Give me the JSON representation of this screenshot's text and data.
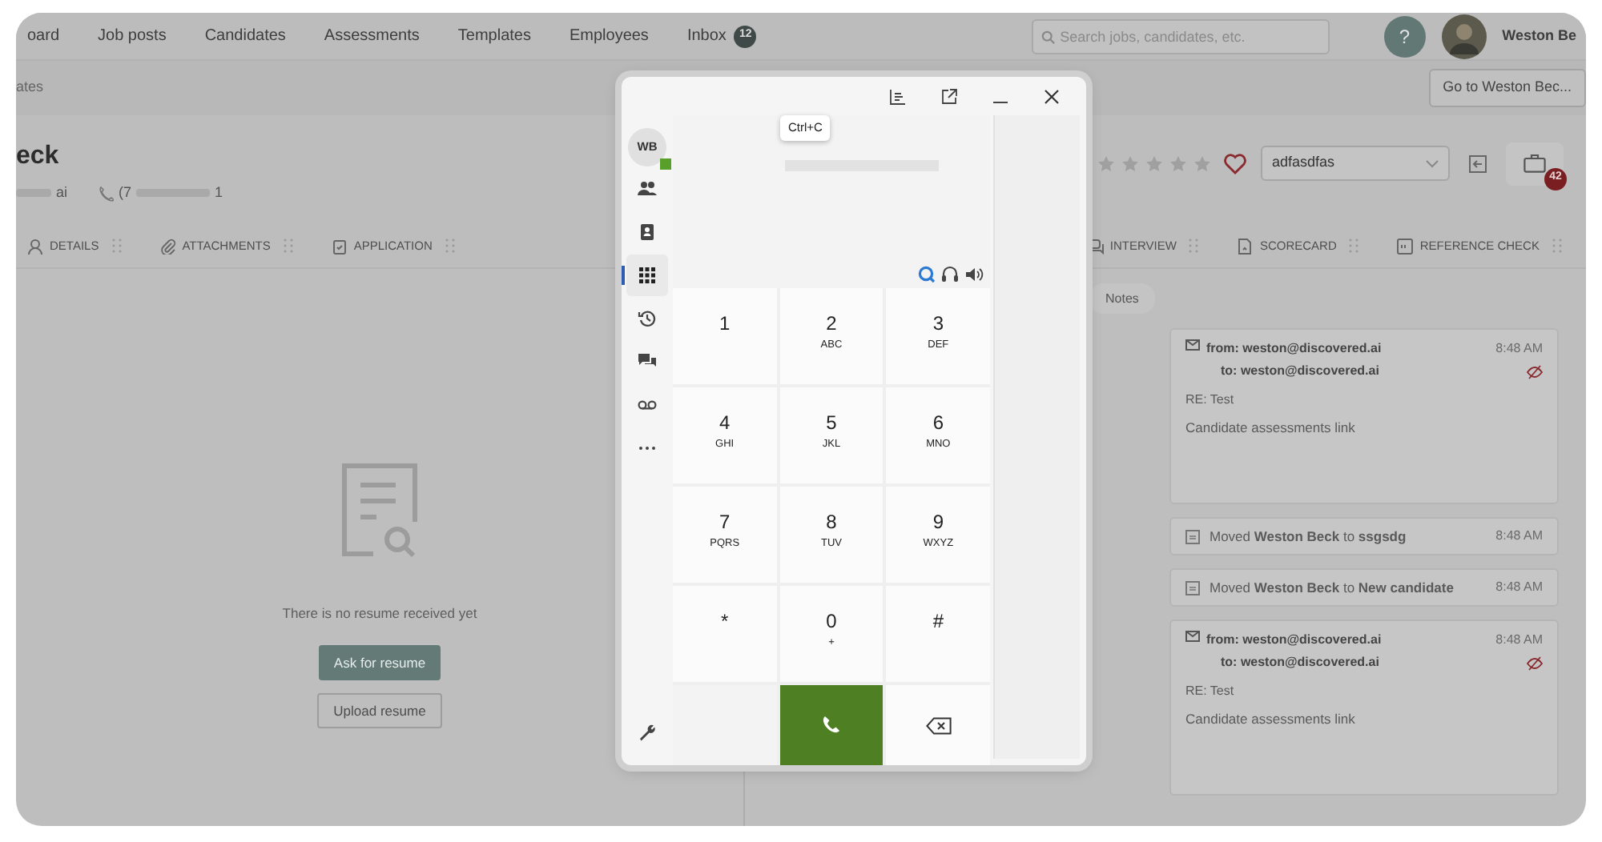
{
  "nav": {
    "items": [
      {
        "label": "oard"
      },
      {
        "label": "Job posts"
      },
      {
        "label": "Candidates"
      },
      {
        "label": "Assessments"
      },
      {
        "label": "Templates"
      },
      {
        "label": "Employees"
      },
      {
        "label": "Inbox",
        "badge": "12"
      }
    ],
    "search": {
      "placeholder": "Search jobs, candidates, etc."
    },
    "help": "?",
    "user": {
      "name": "Weston Be"
    }
  },
  "breadcrumb": "ates",
  "goto_button": "Go to Weston Bec...",
  "candidate": {
    "name": "eck",
    "email": "ai",
    "phone_start": "(7",
    "phone_end": "1",
    "rating": {
      "stars": 0
    },
    "favorite": false,
    "stage": "adfasdfas",
    "jobs_badge": "42"
  },
  "tabs_left": [
    {
      "kind": "person",
      "label": "DETAILS"
    },
    {
      "kind": "clip",
      "label": "ATTACHMENTS"
    },
    {
      "kind": "clipboard",
      "label": "APPLICATION"
    }
  ],
  "tabs_right": [
    {
      "kind": "chat",
      "label": "INTERVIEW"
    },
    {
      "kind": "doc",
      "label": "SCORECARD"
    },
    {
      "kind": "quote",
      "label": "REFERENCE CHECK"
    }
  ],
  "resume": {
    "message": "There is no resume received yet",
    "buttons": [
      {
        "kind": "primary",
        "label": "Ask for resume"
      },
      {
        "kind": "outline",
        "label": "Upload resume"
      }
    ]
  },
  "notes_tab": "Notes",
  "activity": [
    {
      "kind": "email",
      "from": "from: weston@discovered.ai",
      "to": "to: weston@discovered.ai",
      "time": "8:48 AM",
      "subject": "RE: Test",
      "body": "Candidate assessments link"
    },
    {
      "kind": "move",
      "text": "Moved **Weston Beck** to **ssgsdg**",
      "time": "8:48 AM"
    },
    {
      "kind": "move",
      "text": "Moved **Weston Beck** to **New candidate**",
      "time": "8:48 AM"
    },
    {
      "kind": "email",
      "from": "from: weston@discovered.ai",
      "to": "to: weston@discovered.ai",
      "time": "8:48 AM",
      "subject": "RE: Test",
      "body": "Candidate assessments link"
    }
  ],
  "dialer": {
    "avatar": "WB",
    "online": true,
    "tooltip": "Ctrl+C",
    "rail": [
      {
        "kind": "contacts",
        "selected": false
      },
      {
        "kind": "addressbook",
        "selected": false
      },
      {
        "kind": "keypad",
        "selected": true
      },
      {
        "kind": "history",
        "selected": false
      },
      {
        "kind": "chat",
        "selected": false
      },
      {
        "kind": "voicemail",
        "selected": false
      },
      {
        "kind": "more",
        "selected": false
      }
    ],
    "keys": [
      {
        "digit": "1"
      },
      {
        "digit": "2",
        "letters": "ABC"
      },
      {
        "digit": "3",
        "letters": "DEF"
      },
      {
        "digit": "4",
        "letters": "GHI"
      },
      {
        "digit": "5",
        "letters": "JKL"
      },
      {
        "digit": "6",
        "letters": "MNO"
      },
      {
        "digit": "7",
        "letters": "PQRS"
      },
      {
        "digit": "8",
        "letters": "TUV"
      },
      {
        "digit": "9",
        "letters": "WXYZ"
      },
      {
        "digit": "*"
      },
      {
        "digit": "0",
        "letters": "+"
      },
      {
        "digit": "#"
      }
    ]
  }
}
